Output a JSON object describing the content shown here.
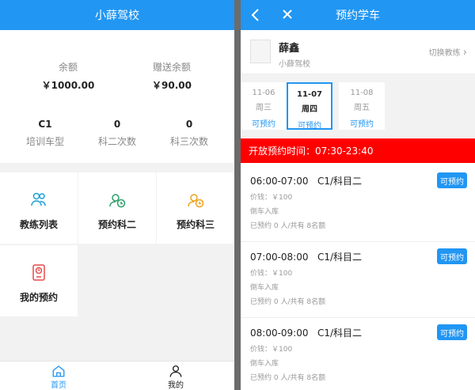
{
  "left": {
    "title": "小薛驾校",
    "balance": {
      "label": "余额",
      "value": "￥1000.00"
    },
    "gift_balance": {
      "label": "赠送余额",
      "value": "￥90.00"
    },
    "training_type": {
      "value": "C1",
      "label": "培训车型"
    },
    "subject2_count": {
      "value": "0",
      "label": "科二次数"
    },
    "subject3_count": {
      "value": "0",
      "label": "科三次数"
    },
    "menu": [
      {
        "label": "教练列表",
        "icon": "coach-list-icon",
        "color": "#1aa0d8"
      },
      {
        "label": "预约科二",
        "icon": "book-subject2-icon",
        "color": "#2e9e6a"
      },
      {
        "label": "预约科三",
        "icon": "book-subject3-icon",
        "color": "#f0a21f"
      },
      {
        "label": "我的预约",
        "icon": "my-booking-icon",
        "color": "#e84a4a"
      }
    ],
    "nav": [
      {
        "label": "首页",
        "icon": "home-icon",
        "active": true
      },
      {
        "label": "我的",
        "icon": "user-icon",
        "active": false
      }
    ],
    "accent_color": "#2196f3"
  },
  "right": {
    "title": "预约学车",
    "coach": {
      "name": "薛鑫",
      "school": "小薛驾校",
      "switch_label": "切换教练"
    },
    "dates": [
      {
        "date": "11-06",
        "weekday": "周三",
        "status": "可预约",
        "active": false
      },
      {
        "date": "11-07",
        "weekday": "周四",
        "status": "可预约",
        "active": true
      },
      {
        "date": "11-08",
        "weekday": "周五",
        "status": "可预约",
        "active": false
      }
    ],
    "open_time": "开放预约时间：07:30-23:40",
    "slots": [
      {
        "time": "06:00-07:00",
        "subject": "C1/科目二",
        "price": "价钱：￥100",
        "type": "倒车入库",
        "quota": "已预约 0 人/共有 8名额",
        "button": "可预约"
      },
      {
        "time": "07:00-08:00",
        "subject": "C1/科目二",
        "price": "价钱：￥100",
        "type": "倒车入库",
        "quota": "已预约 0 人/共有 8名额",
        "button": "可预约"
      },
      {
        "time": "08:00-09:00",
        "subject": "C1/科目二",
        "price": "价钱：￥100",
        "type": "倒车入库",
        "quota": "已预约 0 人/共有 8名额",
        "button": "可预约"
      }
    ],
    "alert_color": "#ff0000"
  }
}
